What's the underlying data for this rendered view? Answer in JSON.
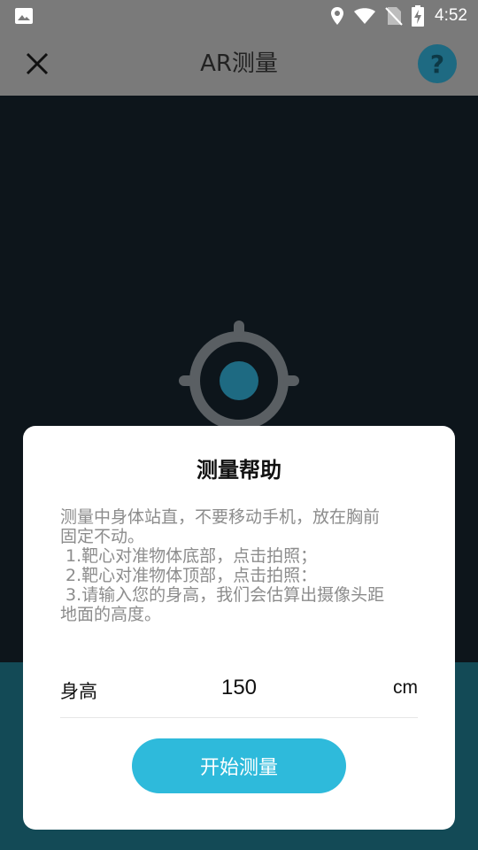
{
  "status_bar": {
    "time": "4:52",
    "icons": [
      "image-icon",
      "location-icon",
      "wifi-icon",
      "no-sim-icon",
      "battery-charging-icon"
    ]
  },
  "app_bar": {
    "title": "AR测量",
    "close_icon": "close-icon",
    "help_icon": "help-icon",
    "help_glyph": "?"
  },
  "dialog": {
    "title": "测量帮助",
    "lines": [
      "测量中身体站直，不要移动手机，放在胸前",
      "固定不动。",
      " 1.靶心对准物体底部，点击拍照；",
      " 2.靶心对准物体顶部，点击拍照：",
      " 3.请输入您的身高，我们会估算出摄像头距",
      "地面的高度。"
    ],
    "height_label": "身高",
    "height_value": "150",
    "height_unit": "cm",
    "start_button": "开始测量"
  },
  "colors": {
    "accent": "#2ebadb",
    "bar": "#7a7a7a",
    "help_circle": "#1e6a82",
    "bottom_band": "#134a56"
  }
}
